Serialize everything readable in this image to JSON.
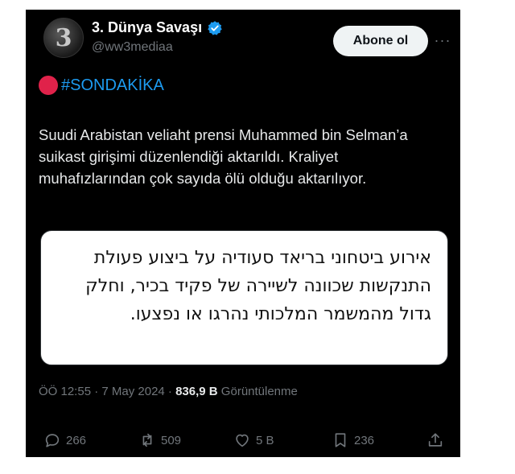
{
  "account": {
    "name": "3. Dünya Savaşı",
    "handle": "@ww3mediaa",
    "avatar_glyph": "3",
    "follow_label": "Abone ol",
    "more_label": "···"
  },
  "tweet": {
    "hashtag": "#SONDAKİKA",
    "text": "Suudi Arabistan veliaht prensi Muhammed bin Selman’a suikast girişimi düzenlendiği aktarıldı. Kraliyet muhafızlarından çok sayıda ölü olduğu aktarılıyor.",
    "media_text_line1": "אירוע ביטחוני בריאד סעודיה על ביצוע פעולת",
    "media_text_line2": "התנקשות שכוונה לשיירה של פקיד בכיר, וחלק",
    "media_text_line3": "גדול מהמשמר המלכותי נהרגו או נפצעו."
  },
  "meta": {
    "time_date": "ÖÖ 12:55 · 7 May 2024 · ",
    "views_count": "836,9 B",
    "views_label": " Görüntülenme"
  },
  "actions": {
    "replies": "266",
    "reposts": "509",
    "likes": "5 B",
    "bookmarks": "236"
  },
  "colors": {
    "background": "#000000",
    "text": "#e7e9ea",
    "secondary": "#71767b",
    "accent": "#1d9bf0",
    "alert_red": "#e0224a"
  },
  "icons": [
    "verified-badge-icon",
    "more-icon",
    "red-circle-icon",
    "reply-icon",
    "repost-icon",
    "like-icon",
    "bookmark-icon",
    "share-icon"
  ]
}
